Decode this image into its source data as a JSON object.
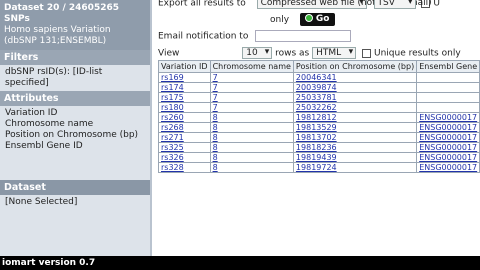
{
  "left": {
    "summary_line1": "Dataset 20 / 24605265 SNPs",
    "dataset_name": "Homo sapiens Variation (dbSNP 131;ENSEMBL)",
    "filters_title": "Filters",
    "filter_text": "dbSNP rsID(s): [ID-list specified]",
    "attributes_title": "Attributes",
    "attributes": [
      "Variation ID",
      "Chromosome name",
      "Position on Chromosome (bp)",
      "Ensembl Gene ID"
    ],
    "dataset2_title": "Dataset",
    "dataset2_value": "[None Selected]"
  },
  "export": {
    "label": "Export  all results to",
    "destination": "Compressed web file (notify by email)",
    "format": "TSV",
    "unique_fragment": "U",
    "only_label": "only",
    "go_label": "Go",
    "email_label": "Email notification to"
  },
  "view": {
    "label": "View",
    "rows_value": "10",
    "rows_as_label": "rows as",
    "format_value": "HTML",
    "unique_label": "Unique results only"
  },
  "table": {
    "headers": [
      "Variation ID",
      "Chromosome name",
      "Position on Chromosome (bp)",
      "Ensembl Gene"
    ],
    "rows": [
      [
        "rs169",
        "7",
        "20046341",
        ""
      ],
      [
        "rs174",
        "7",
        "20039874",
        ""
      ],
      [
        "rs175",
        "7",
        "25033781",
        ""
      ],
      [
        "rs180",
        "7",
        "25032262",
        ""
      ],
      [
        "rs260",
        "8",
        "19812812",
        "ENSG0000017"
      ],
      [
        "rs268",
        "8",
        "19813529",
        "ENSG0000017"
      ],
      [
        "rs271",
        "8",
        "19813702",
        "ENSG0000017"
      ],
      [
        "rs325",
        "8",
        "19818236",
        "ENSG0000017"
      ],
      [
        "rs326",
        "8",
        "19819439",
        "ENSG0000017"
      ],
      [
        "rs328",
        "8",
        "19819724",
        "ENSG0000017"
      ]
    ]
  },
  "footer": {
    "text": "iomart version 0.7"
  }
}
